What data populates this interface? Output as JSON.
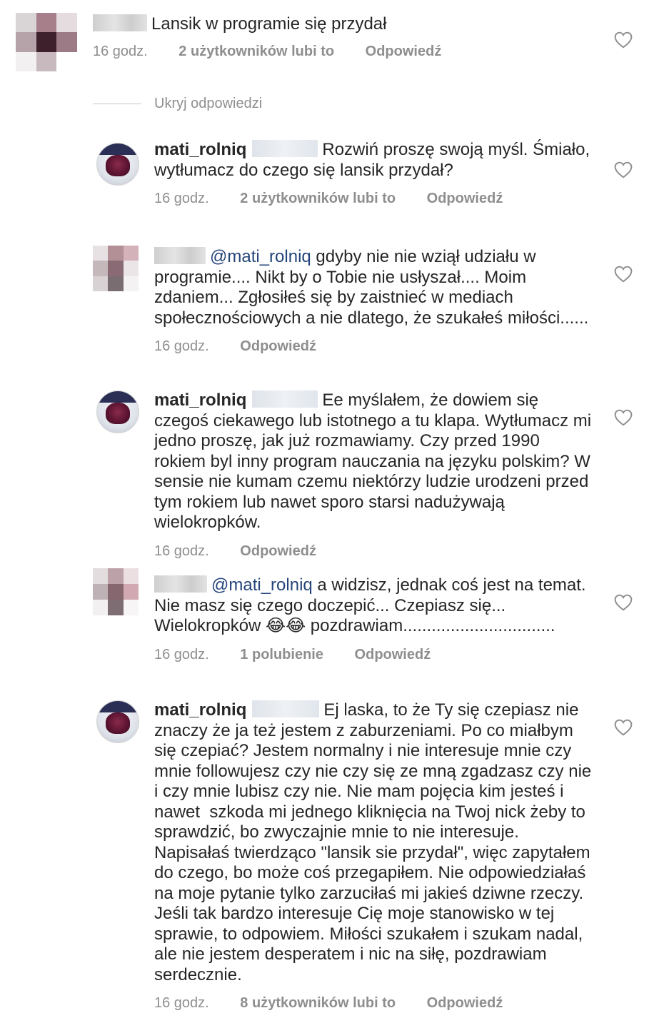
{
  "top_comment": {
    "text": "Lansik w programie się przydał",
    "time": "16 godz.",
    "likes": "2 użytkowników lubi to",
    "reply": "Odpowiedź"
  },
  "hide_replies_label": "Ukryj odpowiedzi",
  "replies": [
    {
      "username": "mati_rolniq",
      "text": "Rozwiń proszę swoją myśl. Śmiało, wytłumacz do czego się lansik przydał?",
      "time": "16 godz.",
      "likes": "2 użytkowników lubi to",
      "reply": "Odpowiedź"
    },
    {
      "mention": "@mati_rolniq",
      "text": " gdyby nie nie wziął udziału w programie.... Nikt by o Tobie nie usłyszał.... Moim zdaniem... Zgłosiłeś się by zaistnieć w mediach społecznościowych a nie dlatego, że szukałeś miłości......",
      "time": "16 godz.",
      "reply": "Odpowiedź"
    },
    {
      "username": "mati_rolniq",
      "text": "Ee myślałem, że dowiem się czegoś ciekawego lub istotnego a tu klapa. Wytłumacz mi jedno proszę, jak już rozmawiamy. Czy przed 1990 rokiem byl inny program nauczania na języku polskim? W sensie nie kumam czemu niektórzy ludzie urodzeni przed tym rokiem lub nawet sporo starsi nadużywają wielokropków.",
      "time": "16 godz.",
      "reply": "Odpowiedź"
    },
    {
      "mention": "@mati_rolniq",
      "text": " a widzisz, jednak coś jest na temat. Nie masz się czego doczepić... Czepiasz się... Wielokropków 😂😂 pozdrawiam................................",
      "time": "16 godz.",
      "likes": "1 polubienie",
      "reply": "Odpowiedź"
    },
    {
      "username": "mati_rolniq",
      "text": "Ej laska, to że Ty się czepiasz nie znaczy że ja też jestem z zaburzeniami. Po co miałbym się czepiać? Jestem normalny i nie interesuje mnie czy mnie followujesz czy nie czy się ze mną zgadzasz czy nie i czy mnie lubisz czy nie. Nie mam pojęcia kim jesteś i nawet  szkoda mi jednego kliknięcia na Twoj nick żeby to sprawdzić, bo zwyczajnie mnie to nie interesuje. Napisałaś twierdząco \"lansik sie przydał\", więc zapytałem do czego, bo może coś przegapiłem. Nie odpowiedziałaś na moje pytanie tylko zarzuciłaś mi jakieś dziwne rzeczy. Jeśli tak bardzo interesuje Cię moje stanowisko w tej sprawie, to odpowiem. Miłości szukałem i szukam nadal, ale nie jestem desperatem i nic na siłę, pozdrawiam serdecznie.",
      "time": "16 godz.",
      "likes": "8 użytkowników lubi to",
      "reply": "Odpowiedź"
    }
  ]
}
